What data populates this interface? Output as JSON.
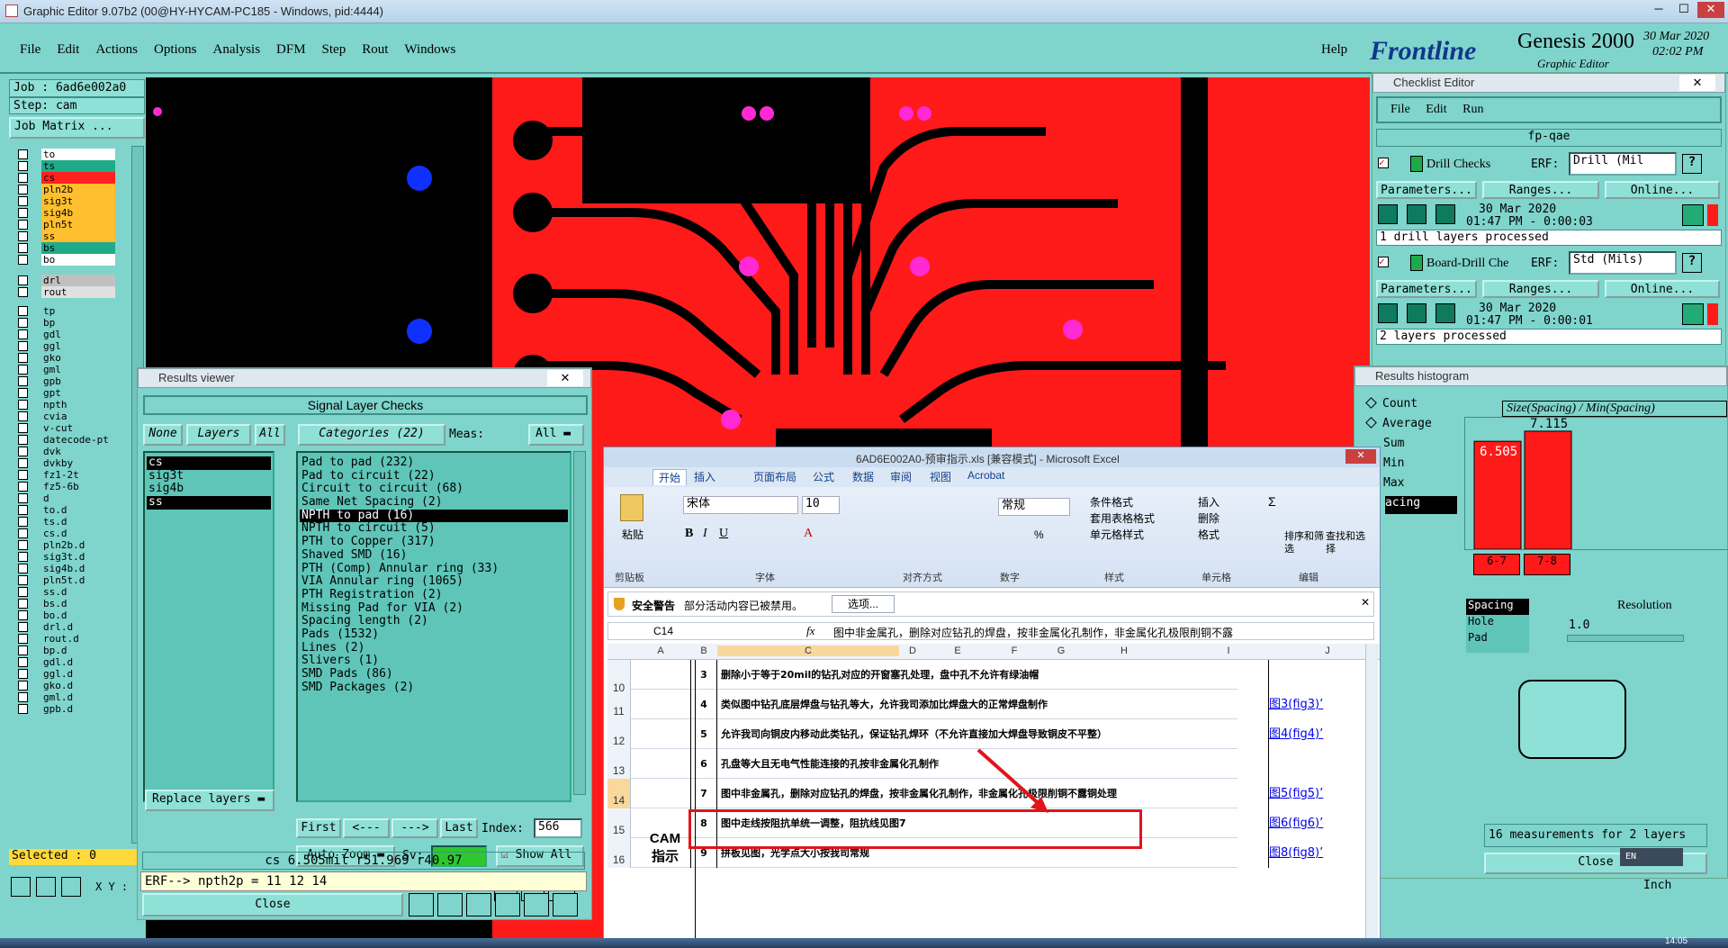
{
  "window": {
    "title": "Graphic Editor 9.07b2 (00@HY-HYCAM-PC185 - Windows, pid:4444)"
  },
  "menu": [
    "File",
    "Edit",
    "Actions",
    "Options",
    "Analysis",
    "DFM",
    "Step",
    "Rout",
    "Windows"
  ],
  "help": "Help",
  "brand": {
    "logo": "Frontline",
    "product": "Genesis 2000",
    "sub": "Graphic Editor",
    "date": "30 Mar 2020",
    "time": "02:02 PM"
  },
  "job": {
    "job_label": "Job : 6ad6e002a0",
    "step_label": "Step: cam",
    "matrix_button": "Job Matrix ..."
  },
  "layers": [
    "to",
    "ts",
    "cs",
    "pln2b",
    "sig3t",
    "sig4b",
    "pln5t",
    "ss",
    "bs",
    "bo",
    "drl",
    "rout",
    "tp",
    "bp",
    "gdl",
    "ggl",
    "gko",
    "gml",
    "gpb",
    "gpt",
    "npth",
    "cvia",
    "v-cut",
    "datecode-pt",
    "dvk",
    "dvkby",
    "fz1-2t",
    "fz5-6b",
    "d",
    "to.d",
    "ts.d",
    "cs.d",
    "pln2b.d",
    "sig3t.d",
    "sig4b.d",
    "pln5t.d",
    "ss.d",
    "bs.d",
    "bo.d",
    "drl.d",
    "rout.d",
    "bp.d",
    "gdl.d",
    "ggl.d",
    "gko.d",
    "gml.d",
    "gpb.d"
  ],
  "colors": {
    "board_red": "#ff1a1a",
    "trace_black": "#000000",
    "pad_magenta": "#ff2ad4",
    "pad_blue": "#1030ff",
    "panel_teal": "#7fd4cc",
    "highlight_red": "#e0141a"
  },
  "selected_label": "Selected : 0",
  "results_viewer": {
    "title": "Results viewer",
    "header": "Signal Layer Checks",
    "none_btn": "None",
    "layers_btn": "Layers",
    "all_btn": "All",
    "categories_label": "Categories (22)",
    "meas_label": "Meas:",
    "meas_value": "All",
    "layers": [
      "cs",
      "sig3t",
      "sig4b",
      "ss"
    ],
    "categories": [
      "Pad to pad (232)",
      "Pad to circuit (22)",
      "Circuit to circuit (68)",
      "Same Net Spacing (2)",
      "NPTH to pad (16)",
      "NPTH to circuit (5)",
      "PTH to Copper (317)",
      "Shaved SMD (16)",
      "PTH (Comp) Annular ring (33)",
      "VIA Annular ring (1065)",
      "PTH Registration (2)",
      "Missing Pad for VIA (2)",
      "Spacing length (2)",
      "Pads (1532)",
      "Lines (2)",
      "Slivers (1)",
      "SMD Pads (86)",
      "SMD Packages (2)"
    ],
    "first": "First",
    "prev": "<---",
    "next": "--->",
    "last": "Last",
    "index_label": "Index:",
    "index_value": "566",
    "auto_zoom": "Auto Zoom",
    "sv": "Sv:",
    "show_all": "Show All",
    "replace_layers": "Replace layers",
    "status1": "cs 6.505mil  r51.969  r40.97",
    "status2": "ERF--> npth2p = 11 12 14",
    "close": "Close",
    "xy": "X Y :"
  },
  "checklist": {
    "title": "Checklist Editor",
    "menu": [
      "File",
      "Edit",
      "Run"
    ],
    "name": "fp-qae",
    "items": [
      {
        "name": "Drill Checks",
        "erf_label": "ERF:",
        "erf_value": "Drill (Mil",
        "params": "Parameters...",
        "ranges": "Ranges...",
        "online": "Online...",
        "date": "30 Mar 2020",
        "time": "01:47 PM - 0:00:03",
        "status": "1 drill layers processed"
      },
      {
        "name": "Board-Drill Che",
        "erf_label": "ERF:",
        "erf_value": "Std (Mils)",
        "params": "Parameters...",
        "ranges": "Ranges...",
        "online": "Online...",
        "date": "30 Mar 2020",
        "time": "01:47 PM - 0:00:01",
        "status": "2 layers processed"
      }
    ]
  },
  "histogram": {
    "title": "Results histogram",
    "options": [
      "Count",
      "Average",
      "Sum",
      "Min",
      "Max",
      "acing"
    ],
    "chart_title": "Size(Spacing) / Min(Spacing)",
    "bar_labels": [
      "6.505",
      "7.115"
    ],
    "bars": [
      6.505,
      7.115
    ],
    "bins": [
      "6-7",
      "7-8"
    ],
    "types": [
      "Spacing",
      "Hole",
      "Pad"
    ],
    "resolution_label": "Resolution",
    "resolution_value": "1.0",
    "measurements": "16 measurements for 2 layers",
    "close": "Close",
    "unit": "Inch"
  },
  "excel": {
    "title": "6AD6E002A0-预审指示.xls [兼容模式] - Microsoft Excel",
    "tabs": [
      "开始",
      "插入",
      "页面布局",
      "公式",
      "数据",
      "审阅",
      "视图",
      "Acrobat"
    ],
    "font_name": "宋体",
    "font_size": "10",
    "number_format": "常规",
    "groups": [
      "剪贴板",
      "字体",
      "对齐方式",
      "数字",
      "样式",
      "单元格",
      "编辑"
    ],
    "paste": "粘贴",
    "style_btns": [
      "条件格式",
      "套用表格格式",
      "单元格样式"
    ],
    "cell_btns": [
      "插入",
      "删除",
      "格式"
    ],
    "edit_btns": [
      "排序和筛选",
      "查找和选择"
    ],
    "security_label": "安全警告",
    "security_msg": "部分活动内容已被禁用。",
    "options_btn": "选项...",
    "cell_ref": "C14",
    "formula": "图中非金属孔，删除对应钻孔的焊盘，按非金属化孔制作，非金属化孔极限削铜不露",
    "columns": [
      "A",
      "B",
      "C",
      "D",
      "E",
      "F",
      "G",
      "H",
      "I",
      "J"
    ],
    "side_label": "CAM\n指示",
    "rows": [
      {
        "rownum": "",
        "num": "3",
        "text": "删除小于等于20mil的钻孔对应的开窗塞孔处理，盘中孔不允许有绿油帽",
        "link": ""
      },
      {
        "rownum": "10",
        "num": "",
        "text": "",
        "link": ""
      },
      {
        "rownum": "11",
        "num": "4",
        "text": "类似图中钻孔底层焊盘与钻孔等大，允许我司添加比焊盘大的正常焊盘制作",
        "link": "图3(fig3)’"
      },
      {
        "rownum": "12",
        "num": "5",
        "text": "允许我司向铜皮内移动此类钻孔，保证钻孔焊环（不允许直接加大焊盘导致铜皮不平整）",
        "link": "图4(fig4)’"
      },
      {
        "rownum": "13",
        "num": "6",
        "text": "孔盘等大且无电气性能连接的孔按非金属化孔制作",
        "link": ""
      },
      {
        "rownum": "14",
        "num": "7",
        "text": "图中非金属孔，删除对应钻孔的焊盘，按非金属化孔制作，非金属化孔极限削铜不露铜处理",
        "link": "图5(fig5)’"
      },
      {
        "rownum": "15",
        "num": "8",
        "text": "图中走线按阻抗单统一调整，阻抗线见图7",
        "link": "图6(fig6)’"
      },
      {
        "rownum": "16",
        "num": "9",
        "text": "拼板见图，光学点大小按我司常规",
        "link": "图8(fig8)’"
      }
    ]
  },
  "taskbar": {
    "time": "14:05",
    "lang": "EN"
  }
}
